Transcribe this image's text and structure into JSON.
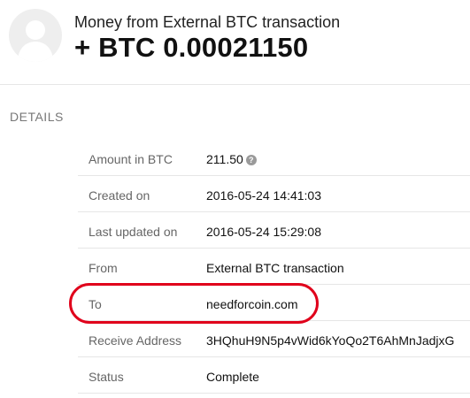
{
  "transaction": {
    "title": "Money from External BTC transaction",
    "amount": "+ BTC 0.00021150"
  },
  "details": {
    "heading": "DETAILS",
    "help_glyph": "?",
    "rows": [
      {
        "label": "Amount in BTC",
        "value": "211.50",
        "has_help_icon": true
      },
      {
        "label": "Created on",
        "value": "2016-05-24 14:41:03"
      },
      {
        "label": "Last updated on",
        "value": "2016-05-24 15:29:08"
      },
      {
        "label": "From",
        "value": "External BTC transaction"
      },
      {
        "label": "To",
        "value": "needforcoin.com",
        "highlighted": true
      },
      {
        "label": "Receive Address",
        "value": "3HQhuH9N5p4vWid6kYoQo2T6AhMnJadjxG"
      },
      {
        "label": "Status",
        "value": "Complete"
      }
    ]
  },
  "colors": {
    "highlight": "#e0001b",
    "divider": "#e6e6e6",
    "avatar_bg": "#eeeeee"
  },
  "icons": {
    "avatar": "user-silhouette-icon",
    "help": "question-circle-icon"
  }
}
